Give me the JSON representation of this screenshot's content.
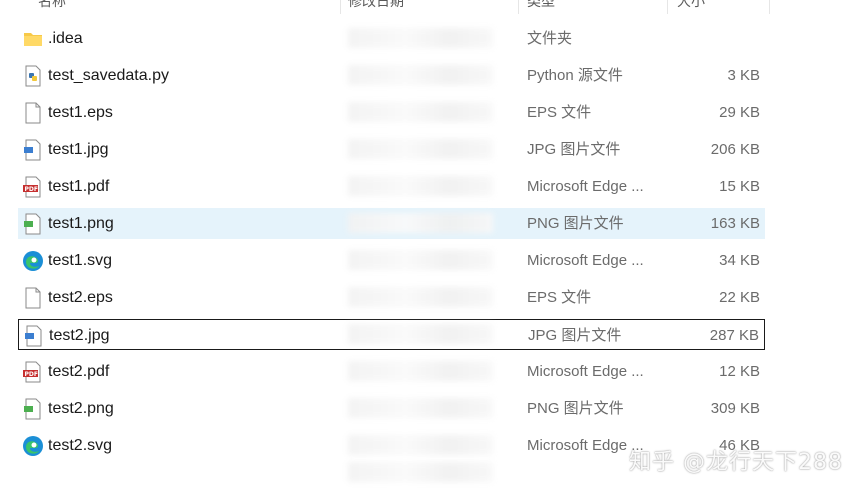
{
  "header": {
    "name": "名称",
    "date": "修改日期",
    "type": "类型",
    "size": "大小"
  },
  "files": [
    {
      "name": ".idea",
      "type": "文件夹",
      "size": "",
      "icon": "folder-icon"
    },
    {
      "name": "test_savedata.py",
      "type": "Python 源文件",
      "size": "3 KB",
      "icon": "python-file-icon"
    },
    {
      "name": "test1.eps",
      "type": "EPS 文件",
      "size": "29 KB",
      "icon": "blank-file-icon"
    },
    {
      "name": "test1.jpg",
      "type": "JPG 图片文件",
      "size": "206 KB",
      "icon": "jpg-file-icon"
    },
    {
      "name": "test1.pdf",
      "type": "Microsoft Edge ...",
      "size": "15 KB",
      "icon": "pdf-file-icon"
    },
    {
      "name": "test1.png",
      "type": "PNG 图片文件",
      "size": "163 KB",
      "icon": "png-file-icon"
    },
    {
      "name": "test1.svg",
      "type": "Microsoft Edge ...",
      "size": "34 KB",
      "icon": "edge-icon"
    },
    {
      "name": "test2.eps",
      "type": "EPS 文件",
      "size": "22 KB",
      "icon": "blank-file-icon"
    },
    {
      "name": "test2.jpg",
      "type": "JPG 图片文件",
      "size": "287 KB",
      "icon": "jpg-file-icon"
    },
    {
      "name": "test2.pdf",
      "type": "Microsoft Edge ...",
      "size": "12 KB",
      "icon": "pdf-file-icon"
    },
    {
      "name": "test2.png",
      "type": "PNG 图片文件",
      "size": "309 KB",
      "icon": "png-file-icon"
    },
    {
      "name": "test2.svg",
      "type": "Microsoft Edge ...",
      "size": "46 KB",
      "icon": "edge-icon"
    }
  ],
  "watermark": "知乎 @龙行天下288",
  "colors": {
    "hover_row": "#e5f3fb",
    "focus_border": "#1a1a1a",
    "secondary_text": "#6b6b6b"
  }
}
